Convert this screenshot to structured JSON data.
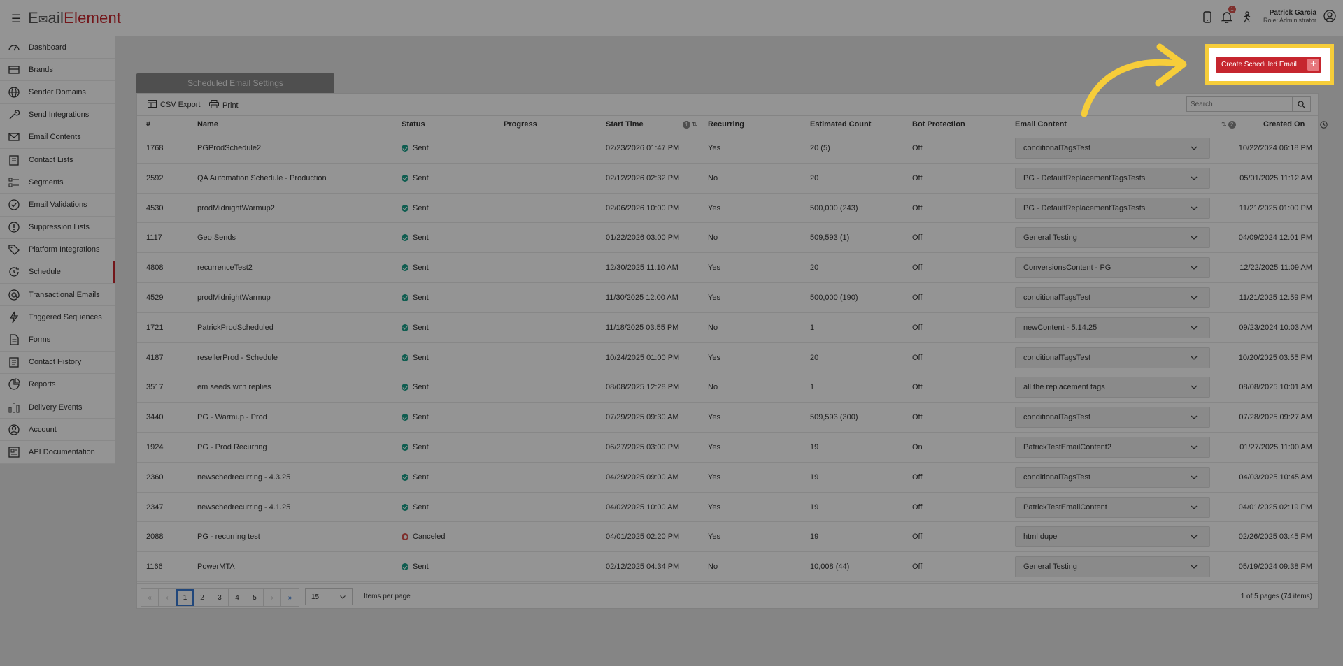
{
  "app": {
    "logo_first": "E",
    "logo_mark": "✉",
    "logo_mid": "ail",
    "logo_last": "Element",
    "notification_count": "1"
  },
  "user": {
    "name": "Patrick Garcia",
    "role": "Role: Administrator"
  },
  "sidebar": {
    "items": [
      {
        "label": "Dashboard",
        "icon": "dashboard-icon"
      },
      {
        "label": "Brands",
        "icon": "brands-icon"
      },
      {
        "label": "Sender Domains",
        "icon": "globe-icon"
      },
      {
        "label": "Send Integrations",
        "icon": "wrench-icon"
      },
      {
        "label": "Email Contents",
        "icon": "envelope-icon"
      },
      {
        "label": "Contact Lists",
        "icon": "clipboard-icon"
      },
      {
        "label": "Segments",
        "icon": "segments-icon"
      },
      {
        "label": "Email Validations",
        "icon": "check-circle-icon"
      },
      {
        "label": "Suppression Lists",
        "icon": "alert-circle-icon"
      },
      {
        "label": "Platform Integrations",
        "icon": "tag-icon"
      },
      {
        "label": "Schedule",
        "icon": "schedule-icon"
      },
      {
        "label": "Transactional Emails",
        "icon": "at-icon"
      },
      {
        "label": "Triggered Sequences",
        "icon": "lightning-icon"
      },
      {
        "label": "Forms",
        "icon": "form-icon"
      },
      {
        "label": "Contact History",
        "icon": "history-icon"
      },
      {
        "label": "Reports",
        "icon": "pie-chart-icon"
      },
      {
        "label": "Delivery Events",
        "icon": "bar-chart-icon"
      },
      {
        "label": "Account",
        "icon": "account-icon"
      },
      {
        "label": "API Documentation",
        "icon": "api-doc-icon"
      }
    ],
    "active": "Schedule"
  },
  "tab": {
    "label": "Scheduled Email Settings"
  },
  "create_button": {
    "label": "Create Scheduled Email",
    "plus": "+"
  },
  "toolbar": {
    "csv_label": "CSV Export",
    "print_label": "Print",
    "search_placeholder": "Search"
  },
  "columns": {
    "id": "#",
    "name": "Name",
    "status": "Status",
    "progress": "Progress",
    "start_time": "Start Time",
    "start_time_sort": "1",
    "recurring": "Recurring",
    "estimated_count": "Estimated Count",
    "bot_protection": "Bot Protection",
    "email_content": "Email Content",
    "email_content_sort": "2",
    "created_on": "Created On"
  },
  "rows": [
    {
      "id": "1768",
      "name": "PGProdSchedule2",
      "status": "Sent",
      "start": "02/23/2026 01:47 PM",
      "recurring": "Yes",
      "count": "20 (5)",
      "bot": "Off",
      "content": "conditionalTagsTest",
      "created": "10/22/2024 06:18 PM"
    },
    {
      "id": "2592",
      "name": "QA Automation Schedule - Production",
      "status": "Sent",
      "start": "02/12/2026 02:32 PM",
      "recurring": "No",
      "count": "20",
      "bot": "Off",
      "content": "PG - DefaultReplacementTagsTests",
      "created": "05/01/2025 11:12 AM"
    },
    {
      "id": "4530",
      "name": "prodMidnightWarmup2",
      "status": "Sent",
      "start": "02/06/2026 10:00 PM",
      "recurring": "Yes",
      "count": "500,000 (243)",
      "bot": "Off",
      "content": "PG - DefaultReplacementTagsTests",
      "created": "11/21/2025 01:00 PM"
    },
    {
      "id": "1117",
      "name": "Geo Sends",
      "status": "Sent",
      "start": "01/22/2026 03:00 PM",
      "recurring": "No",
      "count": "509,593 (1)",
      "bot": "Off",
      "content": "General Testing",
      "created": "04/09/2024 12:01 PM"
    },
    {
      "id": "4808",
      "name": "recurrenceTest2",
      "status": "Sent",
      "start": "12/30/2025 11:10 AM",
      "recurring": "Yes",
      "count": "20",
      "bot": "Off",
      "content": "ConversionsContent - PG",
      "created": "12/22/2025 11:09 AM"
    },
    {
      "id": "4529",
      "name": "prodMidnightWarmup",
      "status": "Sent",
      "start": "11/30/2025 12:00 AM",
      "recurring": "Yes",
      "count": "500,000 (190)",
      "bot": "Off",
      "content": "conditionalTagsTest",
      "created": "11/21/2025 12:59 PM"
    },
    {
      "id": "1721",
      "name": "PatrickProdScheduled",
      "status": "Sent",
      "start": "11/18/2025 03:55 PM",
      "recurring": "No",
      "count": "1",
      "bot": "Off",
      "content": "newContent - 5.14.25",
      "created": "09/23/2024 10:03 AM"
    },
    {
      "id": "4187",
      "name": "resellerProd - Schedule",
      "status": "Sent",
      "start": "10/24/2025 01:00 PM",
      "recurring": "Yes",
      "count": "20",
      "bot": "Off",
      "content": "conditionalTagsTest",
      "created": "10/20/2025 03:55 PM"
    },
    {
      "id": "3517",
      "name": "em seeds with replies",
      "status": "Sent",
      "start": "08/08/2025 12:28 PM",
      "recurring": "No",
      "count": "1",
      "bot": "Off",
      "content": "all the replacement tags",
      "created": "08/08/2025 10:01 AM"
    },
    {
      "id": "3440",
      "name": "PG - Warmup - Prod",
      "status": "Sent",
      "start": "07/29/2025 09:30 AM",
      "recurring": "Yes",
      "count": "509,593 (300)",
      "bot": "Off",
      "content": "conditionalTagsTest",
      "created": "07/28/2025 09:27 AM"
    },
    {
      "id": "1924",
      "name": "PG - Prod Recurring",
      "status": "Sent",
      "start": "06/27/2025 03:00 PM",
      "recurring": "Yes",
      "count": "19",
      "bot": "On",
      "content": "PatrickTestEmailContent2",
      "created": "01/27/2025 11:00 AM"
    },
    {
      "id": "2360",
      "name": "newschedrecurring - 4.3.25",
      "status": "Sent",
      "start": "04/29/2025 09:00 AM",
      "recurring": "Yes",
      "count": "19",
      "bot": "Off",
      "content": "conditionalTagsTest",
      "created": "04/03/2025 10:45 AM"
    },
    {
      "id": "2347",
      "name": "newschedrecurring - 4.1.25",
      "status": "Sent",
      "start": "04/02/2025 10:00 AM",
      "recurring": "Yes",
      "count": "19",
      "bot": "Off",
      "content": "PatrickTestEmailContent",
      "created": "04/01/2025 02:19 PM"
    },
    {
      "id": "2088",
      "name": "PG - recurring test",
      "status": "Canceled",
      "start": "04/01/2025 02:20 PM",
      "recurring": "Yes",
      "count": "19",
      "bot": "Off",
      "content": "html dupe",
      "created": "02/26/2025 03:45 PM"
    },
    {
      "id": "1166",
      "name": "PowerMTA",
      "status": "Sent",
      "start": "02/12/2025 04:34 PM",
      "recurring": "No",
      "count": "10,008 (44)",
      "bot": "Off",
      "content": "General Testing",
      "created": "05/19/2024 09:38 PM"
    }
  ],
  "pager": {
    "first": "«",
    "prev": "‹",
    "next": "›",
    "last": "»",
    "pages": [
      "1",
      "2",
      "3",
      "4",
      "5"
    ],
    "current": "1",
    "page_size": "15",
    "items_per_page_label": "Items per page",
    "info": "1 of 5 pages (74 items)"
  },
  "colors": {
    "brand": "#c6262e",
    "highlight": "#f6cd3a",
    "sent": "#1aa08a",
    "canceled": "#d9534f"
  }
}
